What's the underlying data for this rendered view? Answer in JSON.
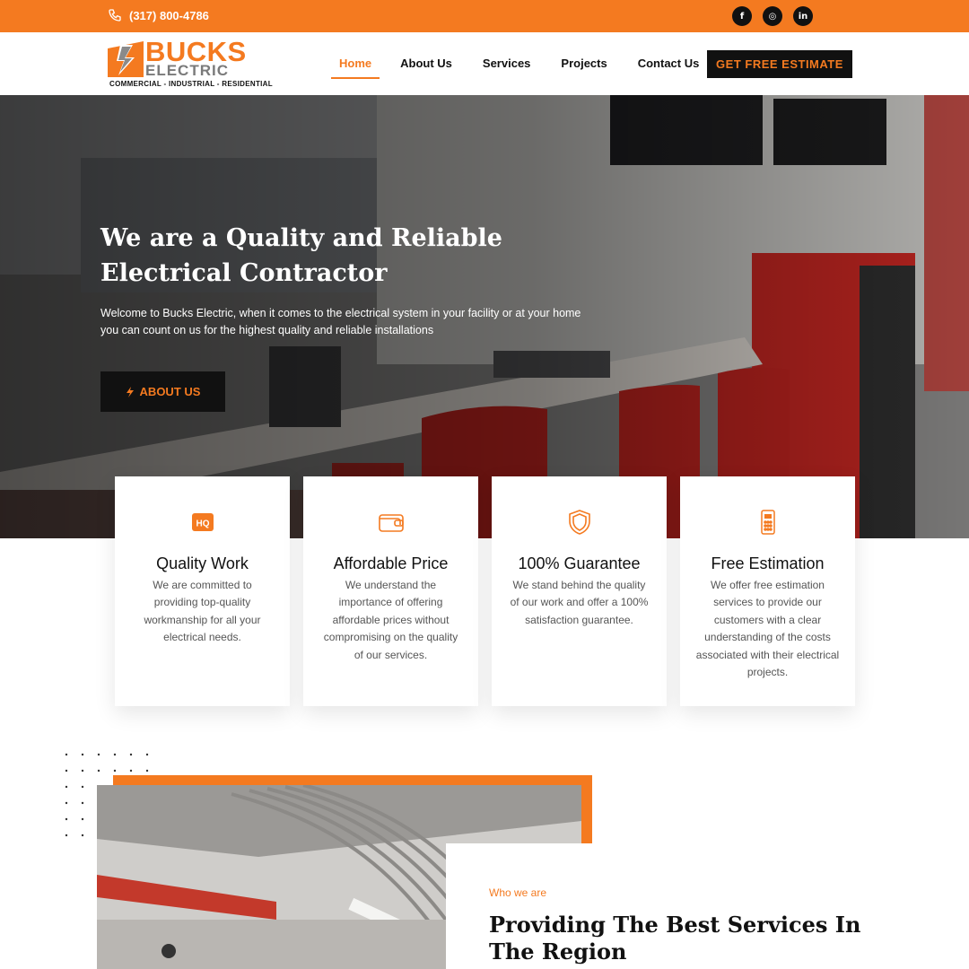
{
  "topbar": {
    "phone": "(317) 800-4786",
    "socials": [
      {
        "icon": "facebook-icon",
        "glyph": "f"
      },
      {
        "icon": "instagram-icon",
        "glyph": "◎"
      },
      {
        "icon": "linkedin-icon",
        "glyph": "in"
      }
    ]
  },
  "header": {
    "logo": {
      "line1": "BUCKS",
      "line2": "ELECTRIC",
      "tagline": "COMMERCIAL - INDUSTRIAL - RESIDENTIAL"
    },
    "nav": [
      "Home",
      "About Us",
      "Services",
      "Projects",
      "Contact Us"
    ],
    "active_nav": "Home",
    "cta_label": "GET FREE ESTIMATE"
  },
  "hero": {
    "title": "We are a Quality and Reliable Electrical Contractor",
    "lead": "Welcome to Bucks Electric, when it comes to the electrical system in your facility or at your home you can count on us for the highest quality and reliable installations",
    "button_label": "ABOUT US"
  },
  "features": [
    {
      "icon": "hq-badge-icon",
      "title": "Quality Work",
      "text": "We are committed to providing top-quality workmanship for all your electrical needs."
    },
    {
      "icon": "wallet-icon",
      "title": "Affordable Price",
      "text": "We understand the importance of offering affordable prices without compromising on the quality of our services."
    },
    {
      "icon": "shield-icon",
      "title": "100% Guarantee",
      "text": "We stand behind the quality of our work and offer a 100% satisfaction guarantee."
    },
    {
      "icon": "estimate-document-icon",
      "title": "Free Estimation",
      "text": "We offer free estimation services to provide our customers with a clear understanding of the costs associated with their electrical projects."
    }
  ],
  "about": {
    "kicker": "Who we are",
    "title": "Providing The Best Services In The Region"
  },
  "colors": {
    "accent": "#f47a20",
    "dark": "#111111",
    "text": "#555555"
  }
}
